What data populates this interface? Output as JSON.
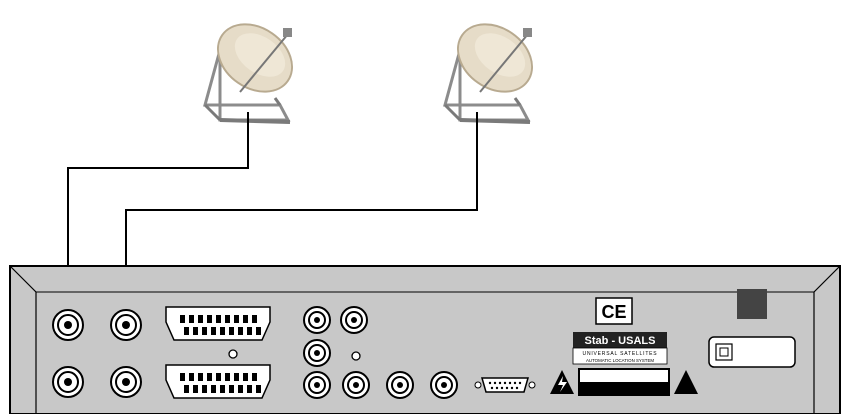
{
  "diagram": {
    "dishes": [
      {
        "name": "satellite-dish-left"
      },
      {
        "name": "satellite-dish-right"
      }
    ],
    "receiver": {
      "ce_mark": "CE",
      "badge": {
        "title": "Stab - USALS",
        "line1": "UNIVERSAL SATELLITES",
        "line2": "AUTOMATIC LOCATION SYSTEM"
      }
    },
    "colors": {
      "panel": "#c8c8c8",
      "outline": "#000000",
      "dish": "#e6dcc8",
      "stand": "#9a9a9a",
      "power-button": "#444444"
    }
  }
}
